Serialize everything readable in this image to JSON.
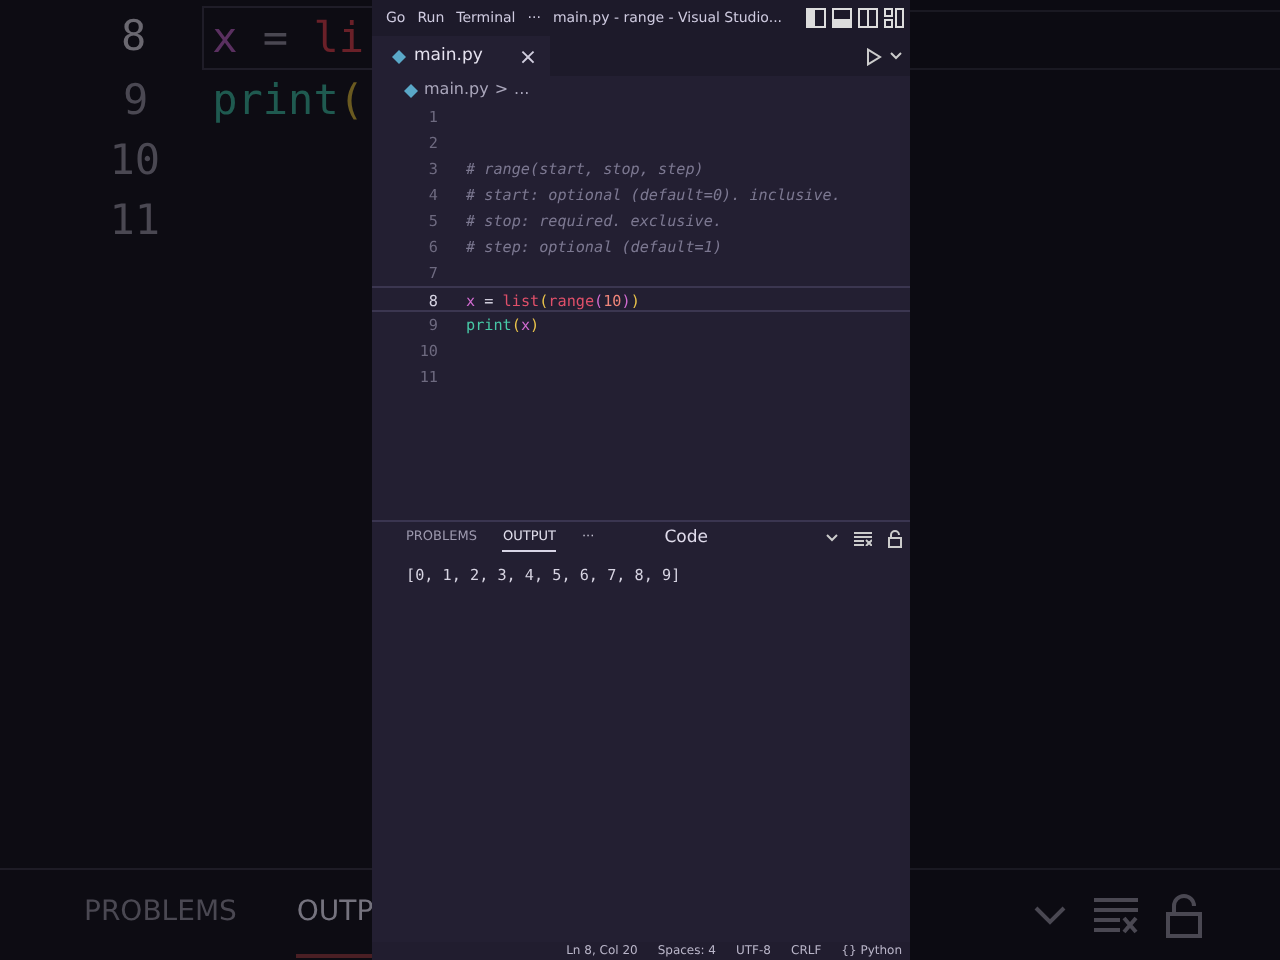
{
  "backdrop": {
    "lines": [
      {
        "number": "8",
        "selected": true,
        "tokens": [
          {
            "text": "x",
            "kind": "variable"
          },
          {
            "text": " = ",
            "kind": "operator"
          },
          {
            "text": "li",
            "kind": "builtin"
          }
        ]
      },
      {
        "number": "9",
        "selected": false,
        "tokens": [
          {
            "text": "print",
            "kind": "function"
          },
          {
            "text": "(",
            "kind": "paren"
          }
        ]
      },
      {
        "number": "10",
        "selected": false
      },
      {
        "number": "11",
        "selected": false
      }
    ],
    "panel_tabs": [
      {
        "label": "PROBLEMS",
        "selected": false
      },
      {
        "label": "OUTP",
        "selected": true
      }
    ]
  },
  "menu": [
    {
      "label": "Go"
    },
    {
      "label": "Run"
    },
    {
      "label": "Terminal"
    },
    {
      "label": "···"
    }
  ],
  "window": {
    "title": "main.py - range - Visual Studio..."
  },
  "tabs": [
    {
      "label": "main.py",
      "selected": true,
      "close": "×"
    }
  ],
  "breadcrumb": {
    "file": "main.py",
    "separator": ">",
    "more": "..."
  },
  "editor": {
    "lines": [
      {
        "number": "1",
        "selected": false
      },
      {
        "number": "2",
        "selected": false
      },
      {
        "number": "3",
        "selected": false,
        "tokens": [
          {
            "text": "# range(start, stop, step)",
            "kind": "comment"
          }
        ]
      },
      {
        "number": "4",
        "selected": false,
        "tokens": [
          {
            "text": "# start: optional (default=0). inclusive.",
            "kind": "comment"
          }
        ]
      },
      {
        "number": "5",
        "selected": false,
        "tokens": [
          {
            "text": "# stop: required. exclusive.",
            "kind": "comment"
          }
        ]
      },
      {
        "number": "6",
        "selected": false,
        "tokens": [
          {
            "text": "# step: optional (default=1)",
            "kind": "comment"
          }
        ]
      },
      {
        "number": "7",
        "selected": false
      },
      {
        "number": "8",
        "selected": true,
        "tokens": [
          {
            "text": "x",
            "kind": "variable"
          },
          {
            "text": " = ",
            "kind": "operator"
          },
          {
            "text": "list",
            "kind": "builtin"
          },
          {
            "text": "(",
            "kind": "paren"
          },
          {
            "text": "range",
            "kind": "builtin"
          },
          {
            "text": "(",
            "kind": "paren2"
          },
          {
            "text": "10",
            "kind": "number"
          },
          {
            "text": ")",
            "kind": "paren2"
          },
          {
            "text": ")",
            "kind": "paren"
          }
        ]
      },
      {
        "number": "9",
        "selected": false,
        "tokens": [
          {
            "text": "print",
            "kind": "function"
          },
          {
            "text": "(",
            "kind": "paren"
          },
          {
            "text": "x",
            "kind": "variable"
          },
          {
            "text": ")",
            "kind": "paren"
          }
        ]
      },
      {
        "number": "10",
        "selected": false
      },
      {
        "number": "11",
        "selected": false
      }
    ]
  },
  "panel": {
    "tabs": [
      {
        "label": "PROBLEMS",
        "selected": false
      },
      {
        "label": "OUTPUT",
        "selected": true
      }
    ],
    "more": "···",
    "channel": "Code",
    "output": "[0, 1, 2, 3, 4, 5, 6, 7, 8, 9]"
  },
  "status_bar": [
    {
      "text": "Ln 8, Col 20"
    },
    {
      "text": "Spaces: 4"
    },
    {
      "text": "UTF-8"
    },
    {
      "text": "CRLF"
    },
    {
      "text": "{} Python"
    }
  ]
}
